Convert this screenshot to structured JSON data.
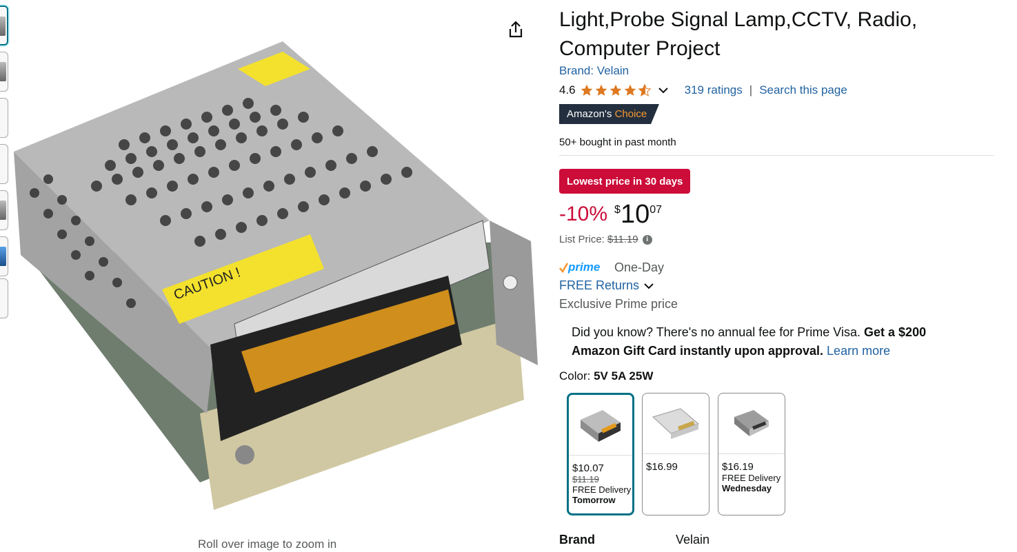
{
  "title_line1": "Light,Probe Signal Lamp,CCTV, Radio,",
  "title_line2": "Computer Project",
  "brand_link": "Brand: Velain",
  "rating": "4.6",
  "ratings_count": "319 ratings",
  "search_page": "Search this page",
  "choice_prefix": "Amazon's",
  "choice_word": "Choice",
  "bought": "50+ bought in past month",
  "deal_badge": "Lowest price in 30 days",
  "price": {
    "discount": "-10%",
    "currency": "$",
    "whole": "10",
    "fraction": "07"
  },
  "list_price_label": "List Price:",
  "list_price": "$11.19",
  "prime_delivery": "One-Day",
  "free_returns": "FREE Returns",
  "exclusive": "Exclusive Prime price",
  "visa_text": "Did you know? There's no annual fee for Prime Visa.",
  "visa_bold": "Get a $200 Amazon Gift Card instantly upon approval.",
  "visa_link": "Learn more",
  "color_label": "Color:",
  "color_value": "5V 5A 25W",
  "swatches": [
    {
      "price": "$10.07",
      "list": "$11.19",
      "delivery": "FREE Delivery",
      "when": "Tomorrow"
    },
    {
      "price": "$16.99"
    },
    {
      "price": "$16.19",
      "delivery": "FREE Delivery",
      "when": "Wednesday"
    }
  ],
  "brand_row": {
    "label": "Brand",
    "value": "Velain"
  },
  "zoom_hint": "Roll over image to zoom in",
  "colors": {
    "link": "#2162A1",
    "deal_red": "#CC0C39",
    "selected_border": "#007185",
    "star": "#DE7921"
  }
}
